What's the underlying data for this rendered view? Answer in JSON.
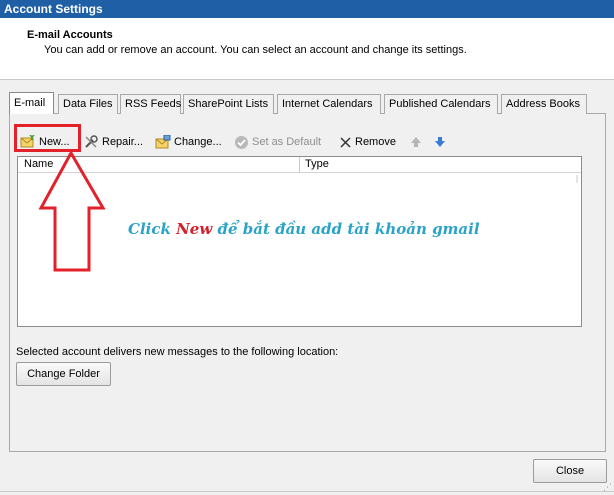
{
  "window": {
    "title": "Account Settings"
  },
  "header": {
    "title": "E-mail Accounts",
    "subtitle": "You can add or remove an account. You can select an account and change its settings."
  },
  "tabs": [
    {
      "label": "E-mail"
    },
    {
      "label": "Data Files"
    },
    {
      "label": "RSS Feeds"
    },
    {
      "label": "SharePoint Lists"
    },
    {
      "label": "Internet Calendars"
    },
    {
      "label": "Published Calendars"
    },
    {
      "label": "Address Books"
    }
  ],
  "toolbar": {
    "new_label": "New...",
    "repair_label": "Repair...",
    "change_label": "Change...",
    "set_default_label": "Set as Default",
    "remove_label": "Remove"
  },
  "list": {
    "col_name": "Name",
    "col_type": "Type",
    "rows": []
  },
  "annotation": {
    "prefix": "Click ",
    "emphasis": "New",
    "suffix": " để bắt đầu add tài khoản gmail"
  },
  "footer": {
    "deliver_text": "Selected account delivers new messages to the following location:",
    "change_folder_label": "Change Folder",
    "close_label": "Close"
  },
  "colors": {
    "titlebar": "#1f5fa6",
    "highlight": "#e2212b",
    "annotation_text": "#2aa3c8",
    "annotation_emphasis": "#d3202a"
  }
}
